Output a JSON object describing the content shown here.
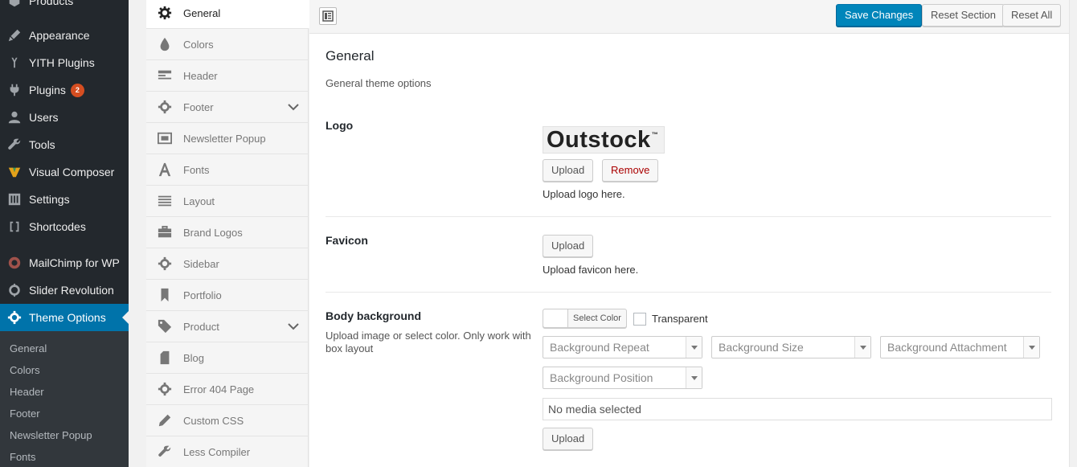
{
  "admin_menu": {
    "items": [
      {
        "label": "Products",
        "icon": "products-icon"
      },
      {
        "label": "Appearance",
        "icon": "appearance-icon"
      },
      {
        "label": "YITH Plugins",
        "icon": "yith-icon"
      },
      {
        "label": "Plugins",
        "icon": "plugins-icon",
        "badge": "2"
      },
      {
        "label": "Users",
        "icon": "users-icon"
      },
      {
        "label": "Tools",
        "icon": "tools-icon"
      },
      {
        "label": "Visual Composer",
        "icon": "visual-composer-icon"
      },
      {
        "label": "Settings",
        "icon": "settings-icon"
      },
      {
        "label": "Shortcodes",
        "icon": "shortcodes-icon"
      },
      {
        "label": "MailChimp for WP",
        "icon": "mailchimp-icon"
      },
      {
        "label": "Slider Revolution",
        "icon": "slider-revolution-icon"
      },
      {
        "label": "Theme Options",
        "icon": "gear-icon",
        "current": true
      }
    ],
    "submenu": [
      "General",
      "Colors",
      "Header",
      "Footer",
      "Newsletter Popup",
      "Fonts"
    ]
  },
  "options_nav": {
    "items": [
      {
        "label": "General",
        "icon": "gear-icon",
        "active": true
      },
      {
        "label": "Colors",
        "icon": "drop-icon"
      },
      {
        "label": "Header",
        "icon": "header-icon"
      },
      {
        "label": "Footer",
        "icon": "gear-icon",
        "expandable": true
      },
      {
        "label": "Newsletter Popup",
        "icon": "popup-icon"
      },
      {
        "label": "Fonts",
        "icon": "font-icon"
      },
      {
        "label": "Layout",
        "icon": "layout-icon"
      },
      {
        "label": "Brand Logos",
        "icon": "briefcase-icon"
      },
      {
        "label": "Sidebar",
        "icon": "gear-icon"
      },
      {
        "label": "Portfolio",
        "icon": "bookmark-icon"
      },
      {
        "label": "Product",
        "icon": "tag-icon",
        "expandable": true
      },
      {
        "label": "Blog",
        "icon": "document-icon"
      },
      {
        "label": "Error 404 Page",
        "icon": "gear-icon"
      },
      {
        "label": "Custom CSS",
        "icon": "pencil-icon"
      },
      {
        "label": "Less Compiler",
        "icon": "wrench-icon"
      }
    ]
  },
  "toolbar": {
    "save_label": "Save Changes",
    "reset_section_label": "Reset Section",
    "reset_all_label": "Reset All"
  },
  "section": {
    "title": "General",
    "description": "General theme options"
  },
  "fields": {
    "logo": {
      "label": "Logo",
      "preview_text": "Outstock",
      "preview_tm": "™",
      "upload_label": "Upload",
      "remove_label": "Remove",
      "description": "Upload logo here."
    },
    "favicon": {
      "label": "Favicon",
      "upload_label": "Upload",
      "description": "Upload favicon here."
    },
    "body_background": {
      "label": "Body background",
      "sub_description": "Upload image or select color. Only work with box layout",
      "select_color_label": "Select Color",
      "transparent_label": "Transparent",
      "transparent_checked": false,
      "selects": {
        "repeat": "Background Repeat",
        "size": "Background Size",
        "attachment": "Background Attachment",
        "position": "Background Position"
      },
      "media_value": "No media selected",
      "upload_label": "Upload"
    }
  },
  "colors": {
    "admin_bg": "#23282d",
    "accent": "#0073aa",
    "primary_button": "#0085ba",
    "badge": "#d54e21"
  }
}
